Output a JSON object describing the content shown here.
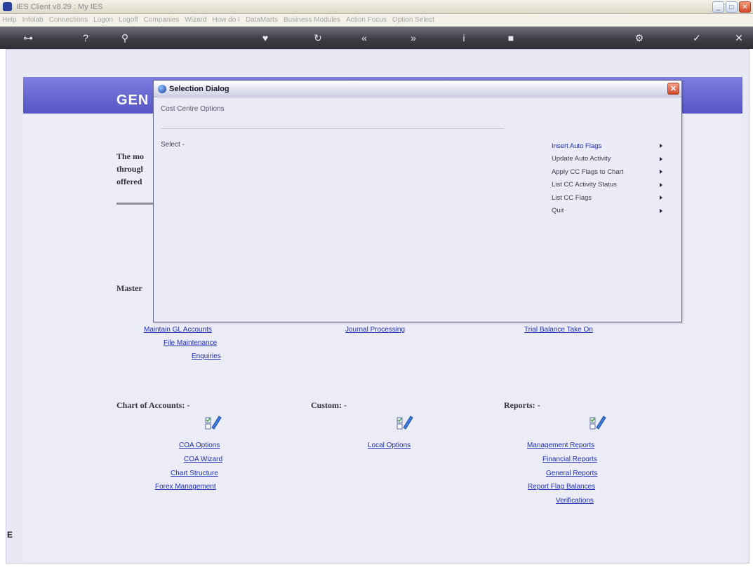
{
  "window": {
    "title": "IES Client v8.29 : My IES"
  },
  "menubar": {
    "items": [
      "Help",
      "Infolab",
      "Connections",
      "Logon",
      "Logoff",
      "Companies",
      "Wizard",
      "How do I",
      "DataMarts",
      "Business Modules",
      "Action Focus",
      "Option Select"
    ]
  },
  "page": {
    "banner_title": "GEN",
    "intro_lines": [
      "The mo",
      "througl",
      "offered"
    ],
    "master_heading": "Master"
  },
  "master_links": {
    "col1": [
      "Maintain GL Accounts",
      "File Maintenance",
      "Enquiries"
    ],
    "col2": [
      "Journal Processing"
    ],
    "col3": [
      "Trial Balance Take On"
    ]
  },
  "sections": {
    "chart_heading": "Chart of Accounts: -",
    "custom_heading": "Custom: -",
    "reports_heading": "Reports: -",
    "chart_links": [
      "COA Options",
      "COA Wizard",
      "Chart Structure",
      "Forex Management"
    ],
    "custom_links": [
      "Local Options"
    ],
    "reports_links": [
      "Management Reports",
      "Financial Reports",
      "General Reports",
      "Report Flag Balances",
      "Verifications"
    ]
  },
  "dialog": {
    "title": "Selection Dialog",
    "subtitle": "Cost Centre Options",
    "select_label": "Select -",
    "menu_items": [
      "Insert Auto Flags",
      "Update Auto Activity",
      "Apply CC Flags to Chart",
      "List CC Activity Status",
      "List CC Flags",
      "Quit"
    ]
  },
  "side": {
    "bottom_left_glyph": "E"
  },
  "colors": {
    "banner": "#6464d2",
    "link": "#1f2fb0",
    "workspace": "#e9e8f5"
  }
}
